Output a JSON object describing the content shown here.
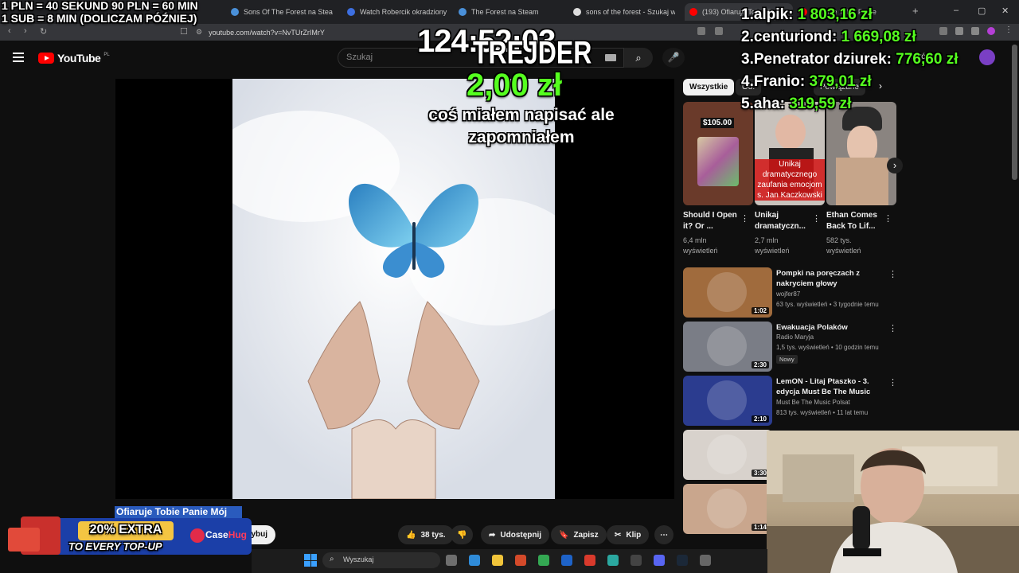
{
  "browser": {
    "tabs": [
      {
        "label": "Sons Of The Forest na Steam",
        "color": "#4a90d9"
      },
      {
        "label": "Watch Robercik okradziony za",
        "color": "#3d6fe0"
      },
      {
        "label": "The Forest na Steam",
        "color": "#4a90d9"
      },
      {
        "label": "sons of the forest - Szukaj w G",
        "color": "#dddddd"
      },
      {
        "label": "(193) Ofiaruje Tobie P",
        "color": "#ff0000",
        "active": true
      },
      {
        "label": "Ofiaruje Tobie Panie",
        "color": "#ff0000"
      }
    ],
    "new_tab": "+",
    "url": "youtube.com/watch?v=NvTUrZrIMrY",
    "window_controls": [
      "–",
      "▢",
      "✕"
    ]
  },
  "youtube": {
    "logo_text": "YouTube",
    "region": "PL",
    "search_placeholder": "Szukaj",
    "signin_fragment": "Utwórz"
  },
  "player": {
    "video_title": "Ofiaruje Tobie Panie Mój",
    "subscribe_fragment": "krybuj",
    "actions": [
      {
        "name": "like",
        "label": "38 tys.",
        "icon": "thumbs-up-icon"
      },
      {
        "name": "dislike",
        "label": "",
        "icon": "thumbs-down-icon"
      },
      {
        "name": "share",
        "label": "Udostępnij",
        "icon": "share-icon"
      },
      {
        "name": "save",
        "label": "Zapisz",
        "icon": "bookmark-icon"
      },
      {
        "name": "clip",
        "label": "Klip",
        "icon": "scissors-icon"
      },
      {
        "name": "more",
        "label": "⋯",
        "icon": "more-icon"
      }
    ]
  },
  "sidebar": {
    "chips": [
      "Wszystkie",
      "Od:",
      "Powiązane"
    ],
    "cards": [
      {
        "title": "Should I Open it? Or ...",
        "views": "6,4 mln",
        "views_label": "wyświetleń",
        "thumb_text": "$105.00",
        "thumb_color": "#6a3a2a"
      },
      {
        "title": "Unikaj dramatyczn...",
        "views": "2,7 mln",
        "views_label": "wyświetleń",
        "thumb_text": "Unikaj dramatycznego zaufania emocjom s. Jan Kaczkowski",
        "thumb_color": "#c8c2bc"
      },
      {
        "title": "Ethan Comes Back To Lif...",
        "views": "582 tys.",
        "views_label": "wyświetleń",
        "thumb_text": "",
        "thumb_color": "#8a8480"
      }
    ],
    "videos": [
      {
        "title": "Pompki na poręczach z nakryciem głowy",
        "channel": "wojfer87",
        "meta": "63 tys. wyświetleń • 3 tygodnie temu",
        "duration": "1:02",
        "badge": "",
        "thumb_color": "#a06b3d"
      },
      {
        "title": "Ewakuacja Polaków",
        "channel": "Radio Maryja",
        "meta": "1,5 tys. wyświetleń • 10 godzin temu",
        "duration": "2:30",
        "badge": "Nowy",
        "thumb_color": "#7a7d86"
      },
      {
        "title": "LemON - Litaj Ptaszko - 3. edycja Must Be The Music",
        "channel": "Must Be The Music Polsat",
        "meta": "813 tys. wyświetleń • 11 lat temu",
        "duration": "2:10",
        "badge": "",
        "thumb_color": "#2b3c8f"
      },
      {
        "title": "",
        "channel": "",
        "meta": "",
        "duration": "3:30",
        "badge": "",
        "thumb_color": "#d8d2cc"
      },
      {
        "title": "",
        "channel": "",
        "meta": "",
        "duration": "1:14",
        "badge": "",
        "thumb_color": "#c9a68d"
      }
    ]
  },
  "overlay": {
    "rate_line1": "1 PLN = 40 SEKUND 90 PLN = 60 MIN",
    "rate_line2": "1 SUB = 8 MIN (DOLICZAM PÓŹNIEJ)",
    "timer": "124:52:03",
    "donor": "TREJDER",
    "amount": "2,00 zł",
    "message": "coś miałem napisać ale zapomniałem",
    "leaderboard": [
      {
        "rank": "1.",
        "name": "alpik:",
        "amount": "1 803,16 zł"
      },
      {
        "rank": "2.",
        "name": "centuriond:",
        "amount": "1 669,08 zł"
      },
      {
        "rank": "3.",
        "name": "Penetrator dziurek:",
        "amount": "776,60 zł"
      },
      {
        "rank": "4.",
        "name": "Franio:",
        "amount": "379,01 zł"
      },
      {
        "rank": "5.",
        "name": "aha:",
        "amount": "319,59 zł"
      }
    ]
  },
  "promo": {
    "headline": "20% EXTRA",
    "subline": "TO EVERY TOP-UP",
    "brand": "Case",
    "brand_accent": "Hug"
  },
  "taskbar": {
    "search_placeholder": "Wyszukaj"
  }
}
